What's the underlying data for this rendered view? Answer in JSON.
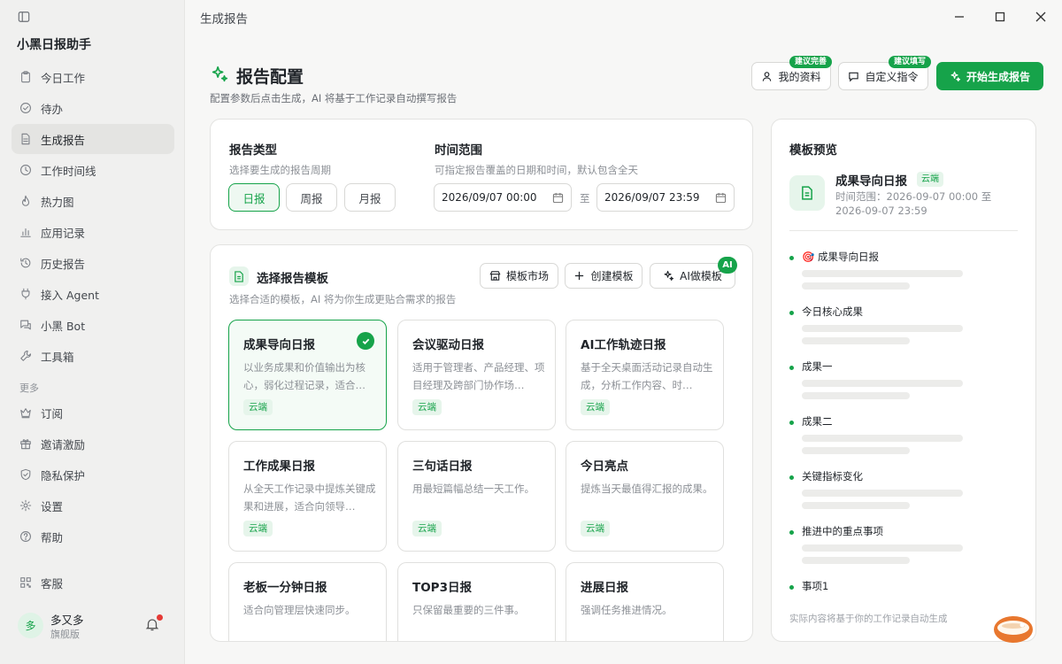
{
  "app": {
    "title": "小黑日报助手",
    "window_title": "生成报告"
  },
  "sidebar": {
    "items": [
      {
        "label": "今日工作",
        "icon": "clipboard-icon"
      },
      {
        "label": "待办",
        "icon": "check-circle-icon"
      },
      {
        "label": "生成报告",
        "icon": "file-text-icon",
        "active": true
      },
      {
        "label": "工作时间线",
        "icon": "clock-icon"
      },
      {
        "label": "热力图",
        "icon": "flame-icon"
      },
      {
        "label": "应用记录",
        "icon": "bar-chart-icon"
      },
      {
        "label": "历史报告",
        "icon": "history-icon"
      },
      {
        "label": "接入 Agent",
        "icon": "plug-icon"
      },
      {
        "label": "小黑 Bot",
        "icon": "chat-icon"
      },
      {
        "label": "工具箱",
        "icon": "wrench-icon"
      }
    ],
    "more_label": "更多",
    "more_items": [
      {
        "label": "订阅",
        "icon": "crown-icon"
      },
      {
        "label": "邀请激励",
        "icon": "gift-icon"
      },
      {
        "label": "隐私保护",
        "icon": "shield-icon"
      },
      {
        "label": "设置",
        "icon": "gear-icon"
      },
      {
        "label": "帮助",
        "icon": "help-icon"
      }
    ],
    "support_label": "客服",
    "user": {
      "avatar": "多",
      "name": "多又多",
      "plan": "旗舰版"
    }
  },
  "header": {
    "title": "报告配置",
    "subtitle": "配置参数后点击生成，AI 将基于工作记录自动撰写报告",
    "profile_button": "我的资料",
    "profile_badge": "建议完善",
    "instruction_button": "自定义指令",
    "instruction_badge": "建议填写",
    "generate_button": "开始生成报告"
  },
  "config": {
    "type_title": "报告类型",
    "type_sub": "选择要生成的报告周期",
    "types": [
      "日报",
      "周报",
      "月报"
    ],
    "range_title": "时间范围",
    "range_sub": "可指定报告覆盖的日期和时间，默认包含全天",
    "start": "2026/09/07 00:00",
    "to_label": "至",
    "end": "2026/09/07 23:59"
  },
  "templates": {
    "title": "选择报告模板",
    "subtitle": "选择合适的模板，AI 将为你生成更贴合需求的报告",
    "market_button": "模板市场",
    "create_button": "创建模板",
    "ai_button": "AI做模板",
    "ai_badge": "AI",
    "items": [
      {
        "name": "成果导向日报",
        "desc": "以业务成果和价值输出为核心，弱化过程记录，适合…",
        "tag": "云端",
        "selected": true
      },
      {
        "name": "会议驱动日报",
        "desc": "适用于管理者、产品经理、项目经理及跨部门协作场…",
        "tag": "云端"
      },
      {
        "name": "AI工作轨迹日报",
        "desc": "基于全天桌面活动记录自动生成，分析工作内容、时…",
        "tag": "云端"
      },
      {
        "name": "工作成果日报",
        "desc": "从全天工作记录中提炼关键成果和进展，适合向领导…",
        "tag": "云端"
      },
      {
        "name": "三句话日报",
        "desc": "用最短篇幅总结一天工作。",
        "tag": "云端"
      },
      {
        "name": "今日亮点",
        "desc": "提炼当天最值得汇报的成果。",
        "tag": "云端"
      },
      {
        "name": "老板一分钟日报",
        "desc": "适合向管理层快速同步。",
        "tag": ""
      },
      {
        "name": "TOP3日报",
        "desc": "只保留最重要的三件事。",
        "tag": ""
      },
      {
        "name": "进展日报",
        "desc": "强调任务推进情况。",
        "tag": ""
      }
    ]
  },
  "preview": {
    "title": "模板预览",
    "name": "成果导向日报",
    "tag": "云端",
    "time": "时间范围：2026-09-07 00:00 至 2026-09-07 23:59",
    "sections": [
      "🎯 成果导向日报",
      "今日核心成果",
      "成果一",
      "成果二",
      "关键指标变化",
      "推进中的重点事项",
      "事项1"
    ],
    "footer": "实际内容将基于你的工作记录自动生成"
  },
  "colors": {
    "accent": "#16a34a",
    "accent_light": "#e6f5eb"
  }
}
